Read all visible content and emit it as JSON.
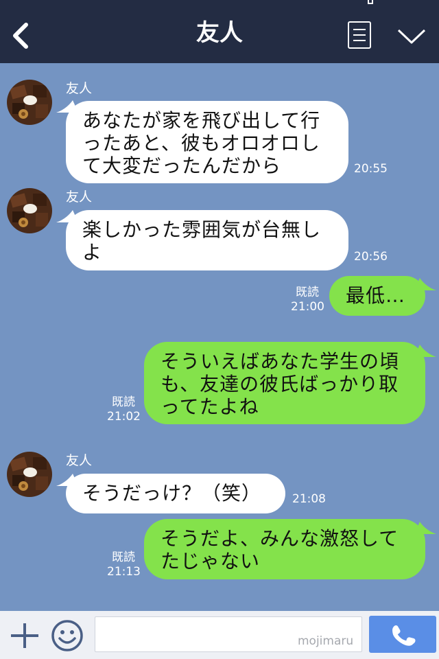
{
  "header": {
    "title": "友人"
  },
  "messages": [
    {
      "sender": "友人",
      "text": "あなたが家を飛び出して行\nったあと、彼もオロオロし\nて大変だったんだから",
      "time": "20:55"
    },
    {
      "sender": "友人",
      "text": "楽しかった雰囲気が台無し\nよ",
      "time": "20:56"
    },
    {
      "read": "既読",
      "time": "21:00",
      "text": "最低…"
    },
    {
      "read": "既読",
      "time": "21:02",
      "text": "そういえばあなた学生の頃\nも、友達の彼氏ばっかり取\nってたよね"
    },
    {
      "sender": "友人",
      "text": "そうだっけ？（笑）",
      "time": "21:08"
    },
    {
      "read": "既読",
      "time": "21:13",
      "text": "そうだよ、みんな激怒して\nたじゃない"
    }
  ],
  "footer": {
    "input_value": "",
    "watermark": "mojimaru"
  },
  "colors": {
    "background": "#7494c2",
    "header": "#232c43",
    "incoming": "#ffffff",
    "outgoing": "#84e24b",
    "call": "#5a8ee6"
  },
  "icons": [
    "back-arrow-icon",
    "menu-icon",
    "chevron-down-icon",
    "plus-icon",
    "emoji-icon",
    "phone-icon"
  ]
}
